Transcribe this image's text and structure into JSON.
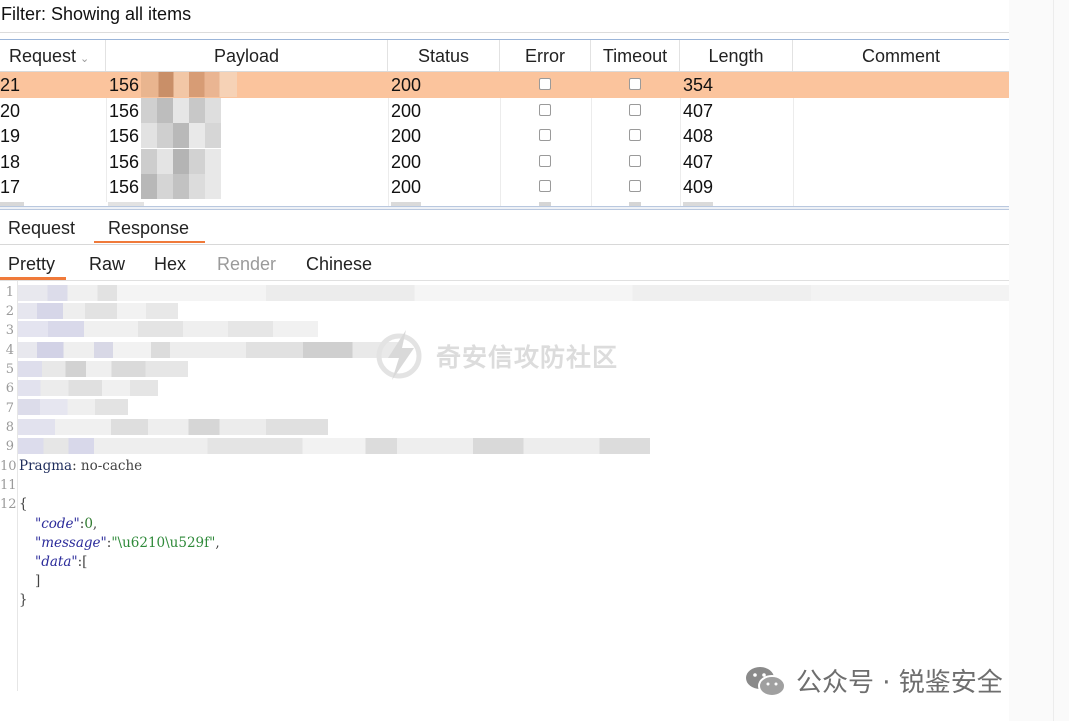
{
  "filter": {
    "text": "Filter: Showing all items"
  },
  "table": {
    "columns": [
      {
        "key": "request",
        "label": "Request"
      },
      {
        "key": "payload",
        "label": "Payload"
      },
      {
        "key": "status",
        "label": "Status"
      },
      {
        "key": "error",
        "label": "Error"
      },
      {
        "key": "timeout",
        "label": "Timeout"
      },
      {
        "key": "length",
        "label": "Length"
      },
      {
        "key": "comment",
        "label": "Comment"
      }
    ],
    "rows": [
      {
        "request": "21",
        "payload": "156",
        "status": "200",
        "error": false,
        "timeout": false,
        "length": "354",
        "selected": true
      },
      {
        "request": "20",
        "payload": "156",
        "status": "200",
        "error": false,
        "timeout": false,
        "length": "407",
        "selected": false
      },
      {
        "request": "19",
        "payload": "156",
        "status": "200",
        "error": false,
        "timeout": false,
        "length": "408",
        "selected": false
      },
      {
        "request": "18",
        "payload": "156",
        "status": "200",
        "error": false,
        "timeout": false,
        "length": "407",
        "selected": false
      },
      {
        "request": "17",
        "payload": "156",
        "status": "200",
        "error": false,
        "timeout": false,
        "length": "409",
        "selected": false
      }
    ]
  },
  "tabs": [
    {
      "label": "Request",
      "active": false
    },
    {
      "label": "Response",
      "active": true
    }
  ],
  "view_tabs": [
    {
      "label": "Pretty",
      "active": true,
      "enabled": true
    },
    {
      "label": "Raw",
      "active": false,
      "enabled": true
    },
    {
      "label": "Hex",
      "active": false,
      "enabled": true
    },
    {
      "label": "Render",
      "active": false,
      "enabled": false
    },
    {
      "label": "Chinese",
      "active": false,
      "enabled": true
    }
  ],
  "editor": {
    "line_numbers": [
      "1",
      "2",
      "3",
      "4",
      "5",
      "6",
      "7",
      "8",
      "9",
      "10",
      "11",
      "12"
    ],
    "header_line": {
      "name": "Pragma",
      "value": "no-cache"
    },
    "json": [
      {
        "key": "\"code\"",
        "value": "0"
      },
      {
        "key": "\"message\"",
        "value": "\"\\u6210\\u529f\""
      },
      {
        "key": "\"data\"",
        "value": "["
      }
    ]
  },
  "watermark": {
    "text": "奇安信攻防社区"
  },
  "footer": {
    "text": "公众号 · 锐鉴安全"
  },
  "colors": {
    "selected_row": "#fbc49d",
    "accent": "#f07a3a"
  }
}
